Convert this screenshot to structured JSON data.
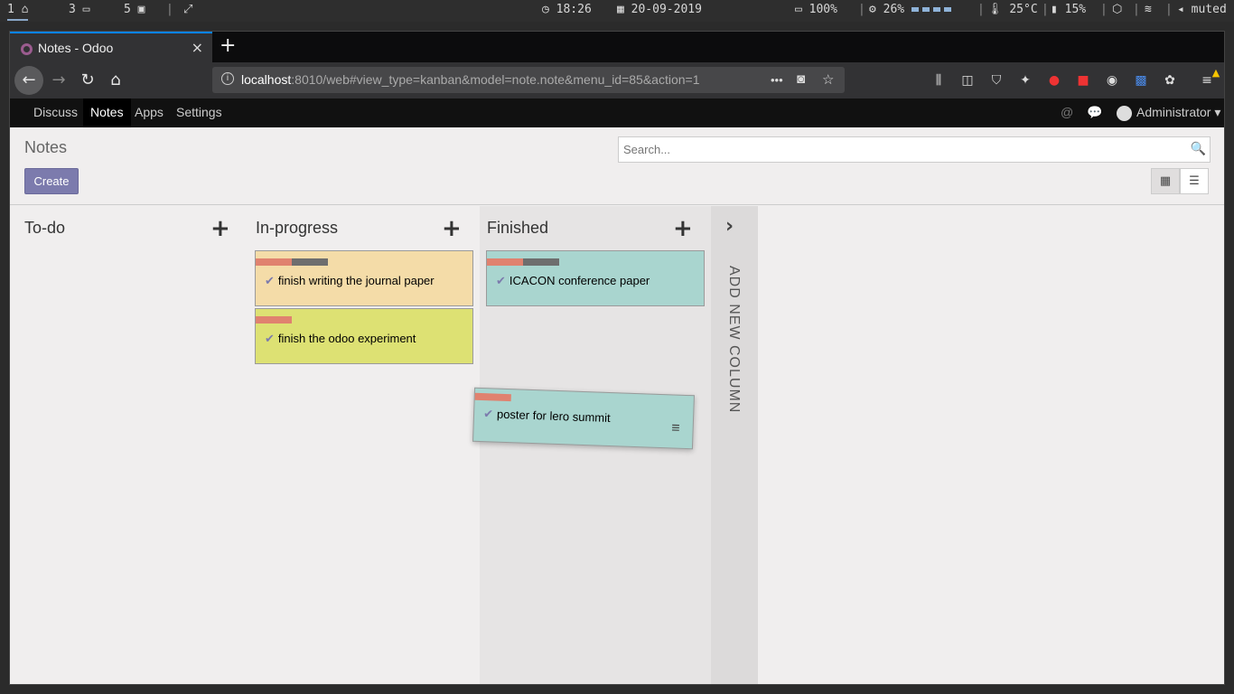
{
  "system_bar": {
    "workspaces": [
      {
        "num": "1",
        "icon": "home-icon",
        "glyph": "⌂"
      },
      {
        "num": "3",
        "icon": "folder-icon",
        "glyph": "▭"
      },
      {
        "num": "5",
        "icon": "terminal-icon",
        "glyph": "▣"
      }
    ],
    "expand_glyph": "⤢",
    "clock": "18:26",
    "date": "20-09-2019",
    "battery": "100%",
    "cpu": "26%",
    "temperature": "25°C",
    "memory": "15%",
    "volume": "muted"
  },
  "browser": {
    "tab_title": "Notes - Odoo",
    "close_glyph": "×",
    "new_tab_glyph": "+",
    "url_host": "localhost",
    "url_path": ":8010/web#view_type=kanban&model=note.note&menu_id=85&action=1",
    "more_glyph": "•••"
  },
  "odoo": {
    "menu": [
      "Discuss",
      "Notes",
      "Apps",
      "Settings"
    ],
    "active_menu": "Notes",
    "user": "Administrator",
    "page_title": "Notes",
    "create_label": "Create",
    "search_placeholder": "Search..."
  },
  "kanban": {
    "columns": [
      {
        "title": "To-do",
        "cards": []
      },
      {
        "title": "In-progress",
        "cards": [
          {
            "text": "finish writing the journal paper",
            "color": "#f4dca8"
          },
          {
            "text": "finish the odoo experiment",
            "color": "#dde173"
          }
        ]
      },
      {
        "title": "Finished",
        "cards": [
          {
            "text": "ICACON conference paper",
            "color": "#a9d5cf"
          }
        ]
      }
    ],
    "dragging_card": {
      "text": "poster for lero summit",
      "color": "#a9d5cf"
    },
    "add_column_label": "ADD NEW COLUMN"
  },
  "colors": {
    "accent": "#7c7bad",
    "tag_red": "#e0826f",
    "tag_gray": "#6e6e6e"
  }
}
